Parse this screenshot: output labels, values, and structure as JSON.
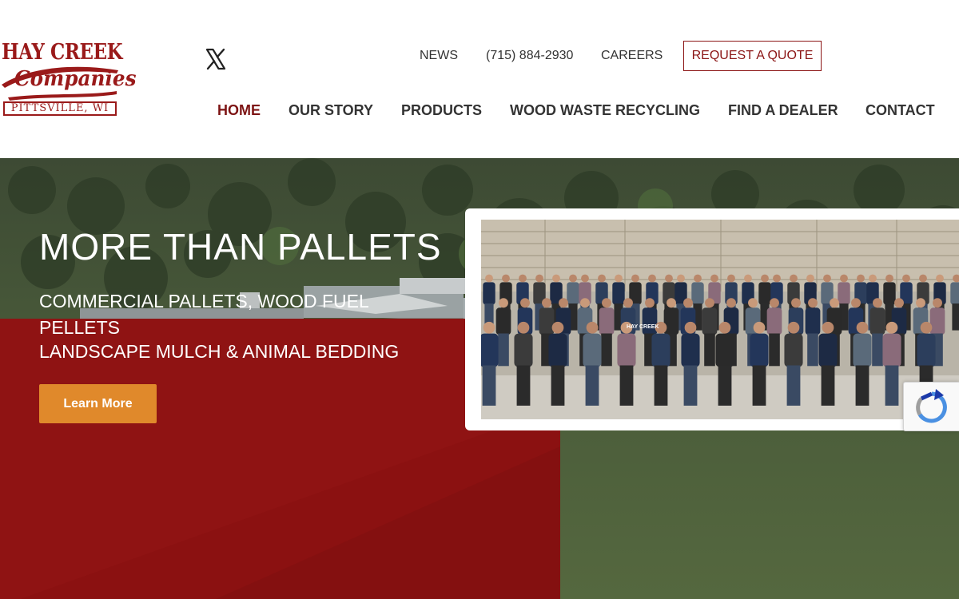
{
  "logo": {
    "line1": "HAY CREEK",
    "line2": "Companies",
    "place": "PITTSVILLE, WI"
  },
  "social": {
    "x_icon": "x-logo-icon"
  },
  "top_nav": {
    "news": "NEWS",
    "phone": "(715) 884-2930",
    "careers": "CAREERS",
    "quote": "REQUEST A QUOTE"
  },
  "main_nav": {
    "home": "HOME",
    "story": "OUR STORY",
    "products": "PRODUCTS",
    "recycling": "WOOD WASTE RECYCLING",
    "dealer": "FIND A DEALER",
    "contact": "CONTACT"
  },
  "hero": {
    "title": "MORE THAN PALLETS",
    "sub1": "COMMERCIAL PALLETS, WOOD FUEL PELLETS",
    "sub2": "LANDSCAPE MULCH & ANIMAL BEDDING",
    "button": "Learn More"
  },
  "team": {
    "shirt_text": "HAY CREEK"
  },
  "colors": {
    "brand_red": "#8b1111",
    "active_nav": "#7d1414",
    "button_orange": "#e0892b",
    "text_dark": "#333333"
  },
  "icons": {
    "recaptcha": "recaptcha-icon"
  }
}
